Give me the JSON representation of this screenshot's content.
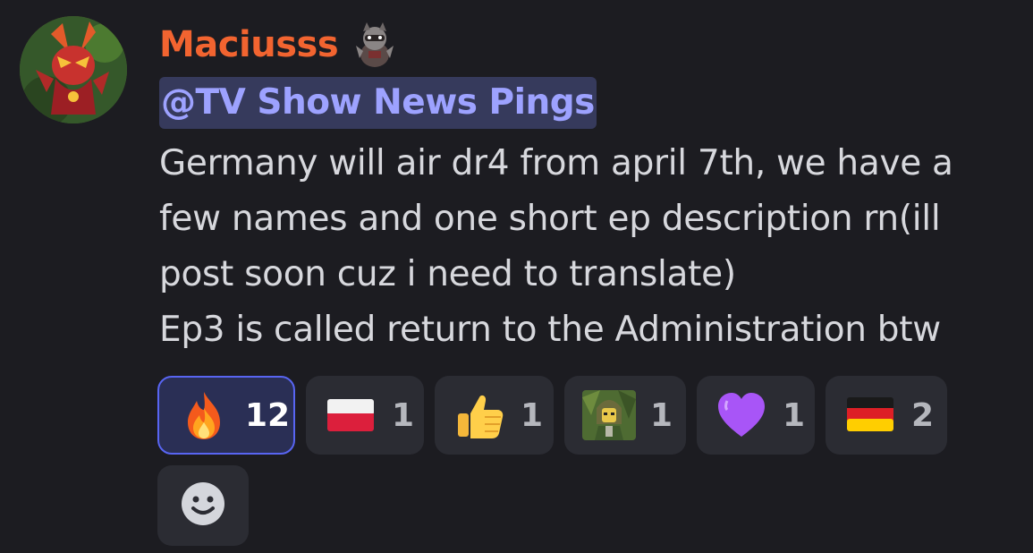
{
  "message": {
    "username": "Maciusss",
    "username_color": "#f26430",
    "mention": "@TV Show News Pings",
    "mention_text_color": "#9da2ff",
    "mention_bg": "#363a5c",
    "text": "Germany will air dr4 from april 7th, we have a\nfew names and one short ep description rn(ill\npost soon cuz i need to translate)\nEp3 is called return to the Administration btw"
  },
  "reactions": [
    {
      "emoji": "fire-emoji",
      "count": "12",
      "active": true
    },
    {
      "emoji": "poland-flag-emoji",
      "count": "1",
      "active": false
    },
    {
      "emoji": "thumbs-up-emoji",
      "count": "1",
      "active": false
    },
    {
      "emoji": "custom-character-emoji",
      "count": "1",
      "active": false
    },
    {
      "emoji": "purple-heart-emoji",
      "count": "1",
      "active": false
    },
    {
      "emoji": "germany-flag-emoji",
      "count": "2",
      "active": false
    }
  ],
  "add_reaction_icon": "smiley-icon",
  "colors": {
    "background": "#1c1c21",
    "chip": "#2b2c33",
    "chip_active_bg": "#2a2f55",
    "chip_active_border": "#5865f2",
    "text": "#d7d8dd"
  }
}
